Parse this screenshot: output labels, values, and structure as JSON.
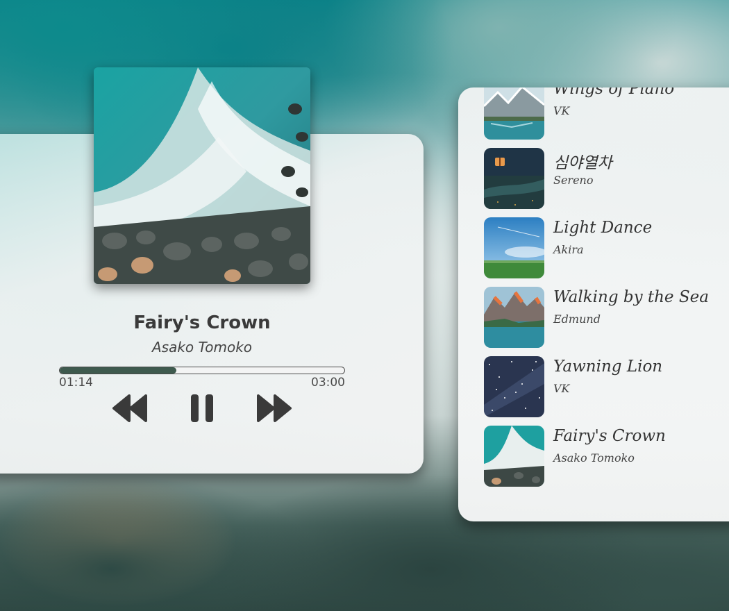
{
  "player": {
    "title": "Fairy's Crown",
    "artist": "Asako Tomoko",
    "current_time": "01:14",
    "total_time": "03:00",
    "progress": 0.41,
    "controls": {
      "prev_icon": "rewind-icon",
      "play_icon": "pause-icon",
      "next_icon": "fast-forward-icon"
    }
  },
  "playlist": {
    "tracks": [
      {
        "title": "Wings of Piano",
        "artist": "VK"
      },
      {
        "title": "심야열차",
        "artist": "Sereno"
      },
      {
        "title": "Light Dance",
        "artist": "Akira"
      },
      {
        "title": "Walking by the Sea",
        "artist": "Edmund"
      },
      {
        "title": "Yawning Lion",
        "artist": "VK"
      },
      {
        "title": "Fairy's Crown",
        "artist": "Asako Tomoko"
      }
    ]
  },
  "colors": {
    "progress_fill": "#3e5a4e",
    "control_icon": "#3a3a3a",
    "text": "#333333"
  }
}
